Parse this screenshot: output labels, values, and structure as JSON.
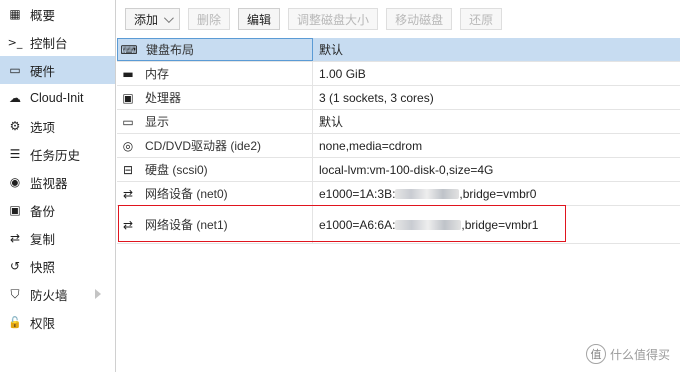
{
  "sidebar": {
    "items": [
      {
        "label": "概要",
        "icon": "summary-icon",
        "glyph": "▦"
      },
      {
        "label": "控制台",
        "icon": "console-icon",
        "glyph": ">_"
      },
      {
        "label": "硬件",
        "icon": "monitor-icon",
        "glyph": "▭"
      },
      {
        "label": "Cloud-Init",
        "icon": "cloud-icon",
        "glyph": "☁"
      },
      {
        "label": "选项",
        "icon": "gear-icon",
        "glyph": "⚙"
      },
      {
        "label": "任务历史",
        "icon": "list-icon",
        "glyph": "☰"
      },
      {
        "label": "监视器",
        "icon": "eye-icon",
        "glyph": "◉"
      },
      {
        "label": "备份",
        "icon": "floppy-icon",
        "glyph": "▣"
      },
      {
        "label": "复制",
        "icon": "retweet-icon",
        "glyph": "⇄"
      },
      {
        "label": "快照",
        "icon": "history-icon",
        "glyph": "↺"
      },
      {
        "label": "防火墙",
        "icon": "shield-icon",
        "glyph": "⛉"
      },
      {
        "label": "权限",
        "icon": "unlock-icon",
        "glyph": "🔓"
      }
    ]
  },
  "toolbar": {
    "add": "添加",
    "remove": "删除",
    "edit": "编辑",
    "resize": "调整磁盘大小",
    "move": "移动磁盘",
    "revert": "还原"
  },
  "hardware": [
    {
      "icon": "keyboard-icon",
      "glyph": "⌨",
      "label": "键盘布局",
      "value": "默认"
    },
    {
      "icon": "memory-icon",
      "glyph": "▬",
      "label": "内存",
      "value": "1.00 GiB"
    },
    {
      "icon": "cpu-icon",
      "glyph": "▣",
      "label": "处理器",
      "value": "3 (1 sockets, 3 cores)"
    },
    {
      "icon": "display-icon",
      "glyph": "▭",
      "label": "显示",
      "value": "默认"
    },
    {
      "icon": "cdrom-icon",
      "glyph": "◎",
      "label": "CD/DVD驱动器 (ide2)",
      "value": "none,media=cdrom"
    },
    {
      "icon": "harddisk-icon",
      "glyph": "⊟",
      "label": "硬盘 (scsi0)",
      "value": "local-lvm:vm-100-disk-0,size=4G"
    },
    {
      "icon": "network-icon",
      "glyph": "⇄",
      "label": "网络设备 (net0)",
      "value_prefix": "e1000=1A:3B:",
      "value_suffix": ",bridge=vmbr0"
    },
    {
      "icon": "network-icon",
      "glyph": "⇄",
      "label": "网络设备 (net1)",
      "value_prefix": "e1000=A6:6A:",
      "value_suffix": ",bridge=vmbr1"
    }
  ],
  "watermark": {
    "badge": "值",
    "text": "什么值得买"
  }
}
